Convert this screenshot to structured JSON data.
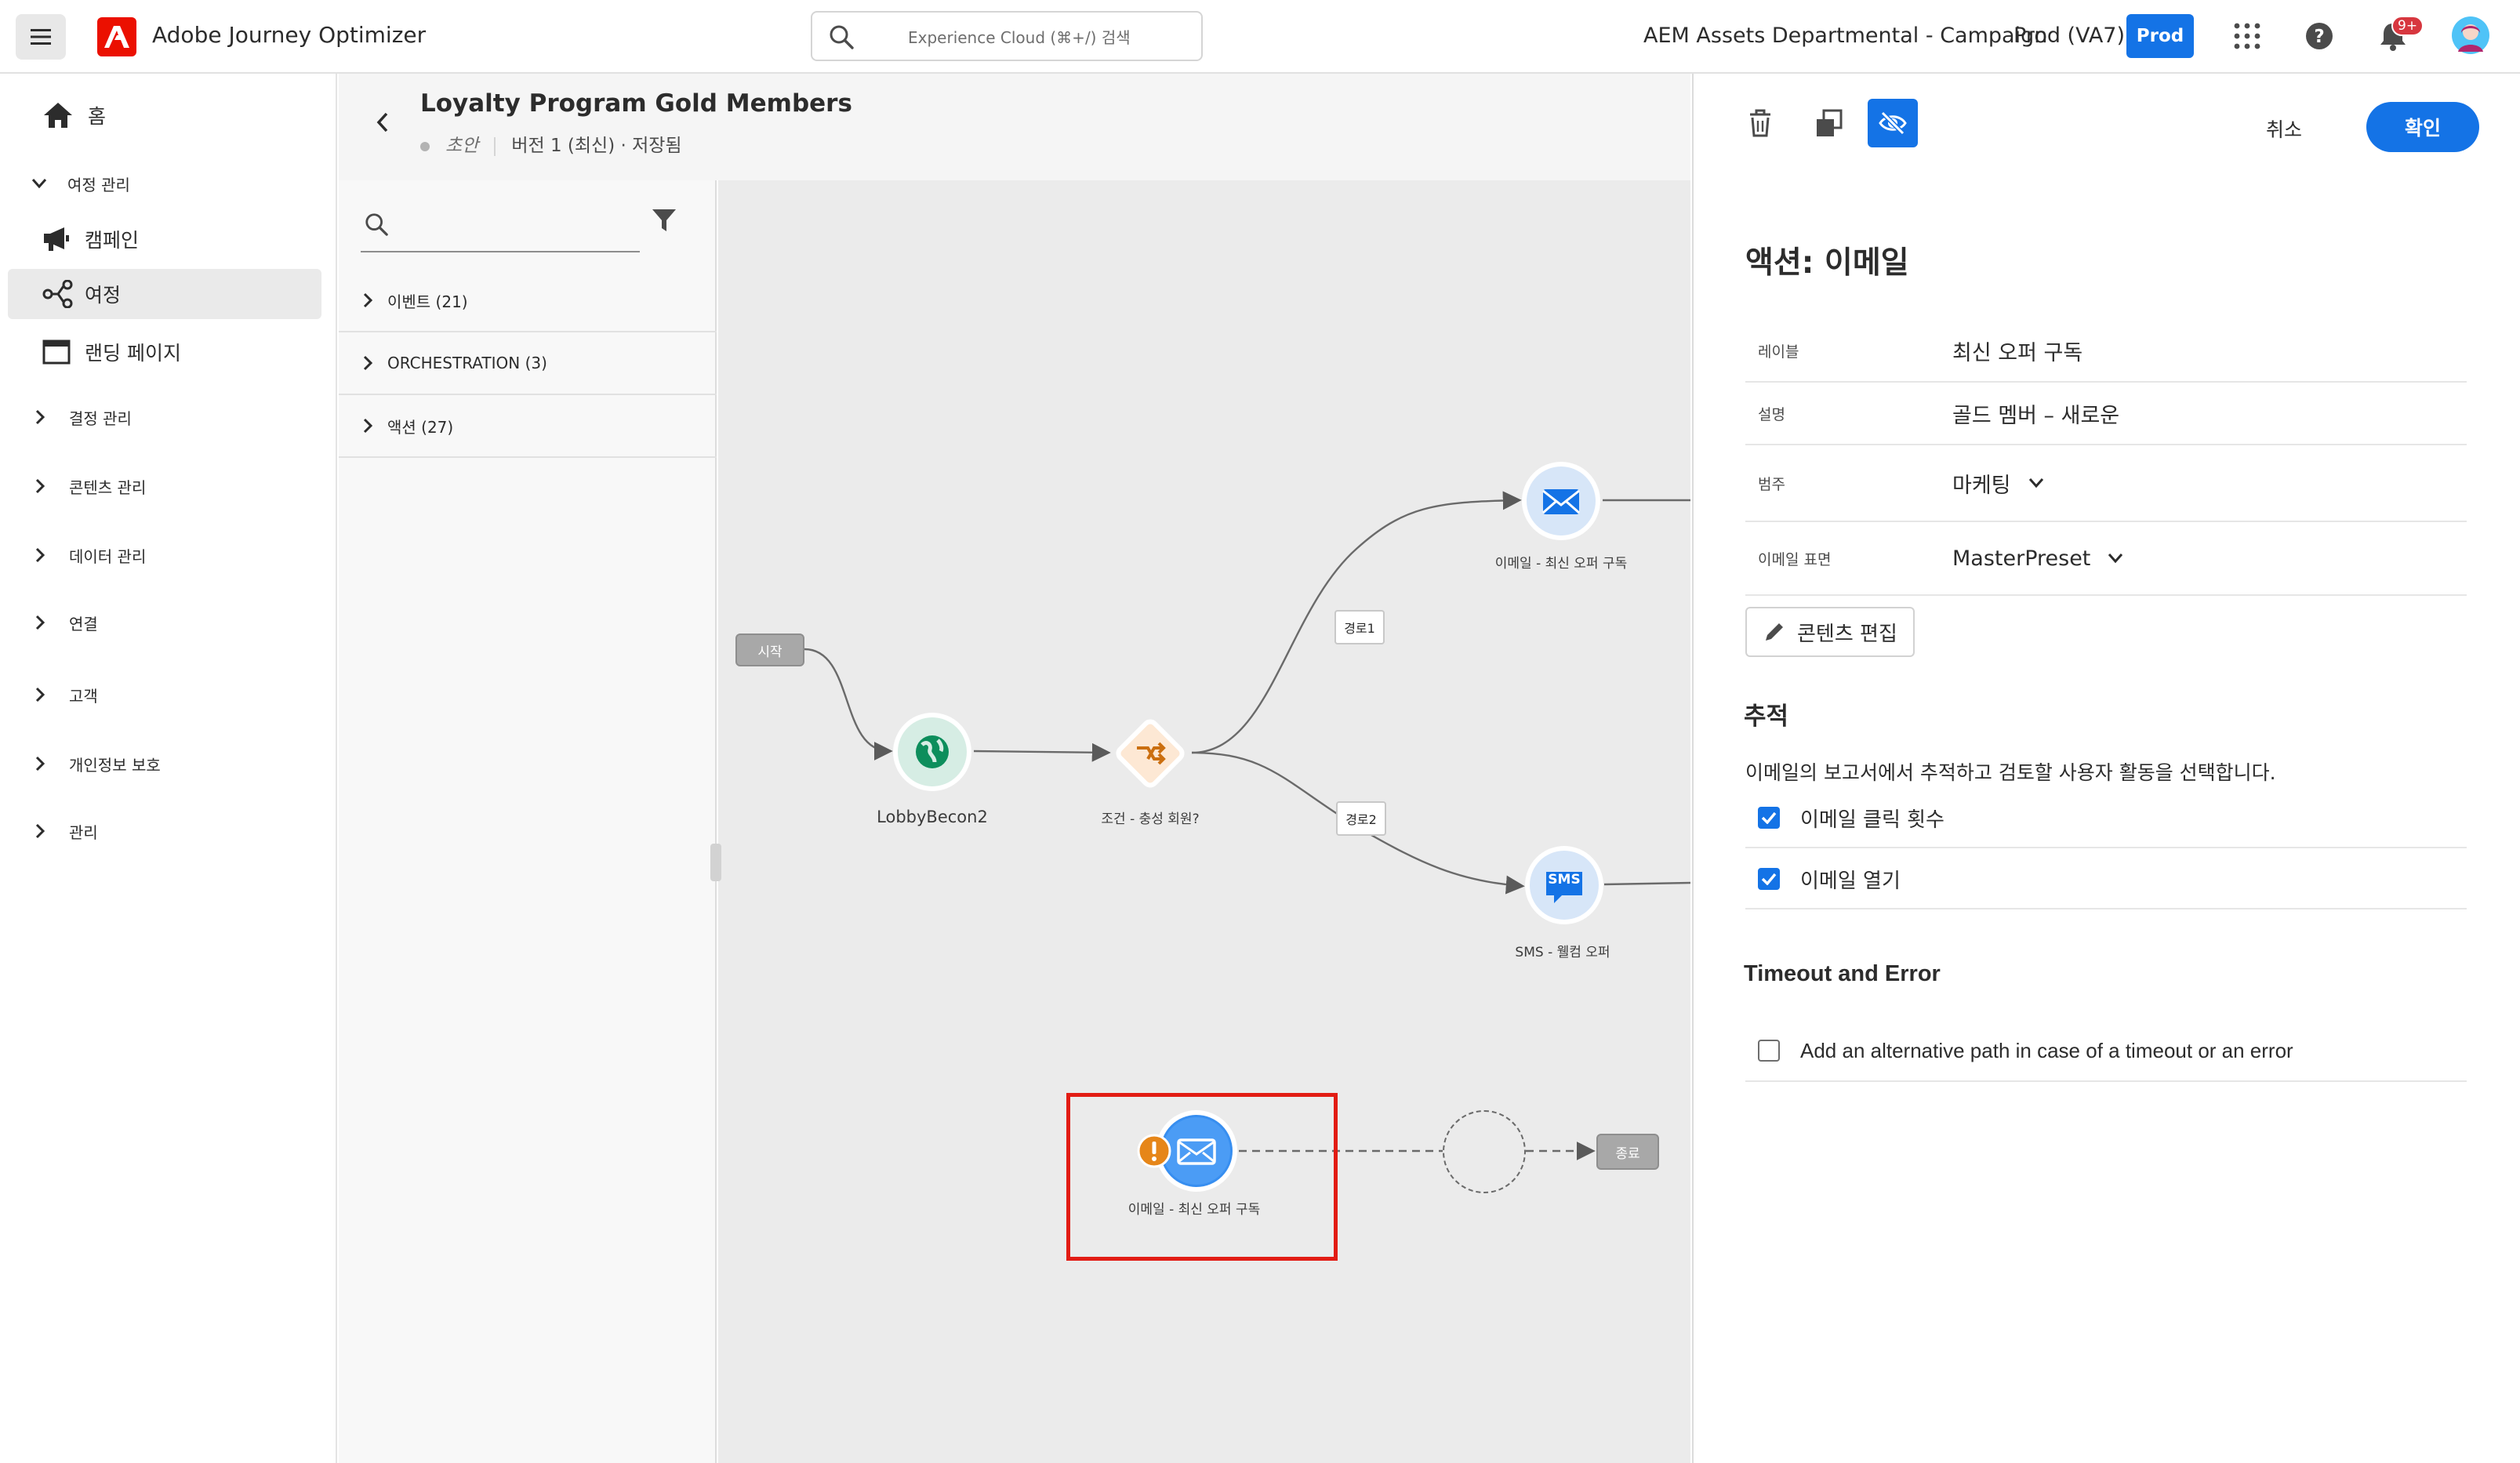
{
  "header": {
    "app_name": "Adobe Journey Optimizer",
    "search_placeholder": "Experience Cloud (⌘+/) 검색",
    "org_name": "AEM Assets Departmental - Campaign",
    "sandbox_name": "Prod (VA7)",
    "env_badge": "Prod",
    "notif_count": "9+"
  },
  "nav": {
    "home": "홈",
    "journey_management": "여정 관리",
    "campaigns": "캠페인",
    "journeys": "여정",
    "landing_pages": "랜딩 페이지",
    "decision_management": "결정 관리",
    "content_management": "콘텐츠 관리",
    "data_management": "데이터 관리",
    "connections": "연결",
    "customers": "고객",
    "privacy": "개인정보 보호",
    "administration": "관리"
  },
  "journey": {
    "title": "Loyalty Program Gold Members",
    "status": "초안",
    "version": "버전 1 (최신) · 저장됨"
  },
  "palette": {
    "items": [
      {
        "label": "이벤트 (21)"
      },
      {
        "label": "ORCHESTRATION (3)"
      },
      {
        "label": "액션 (27)"
      }
    ]
  },
  "canvas": {
    "start": "시작",
    "event_node": "LobbyBecon2",
    "condition_node": "조건 - 충성 회원?",
    "path1": "경로1",
    "path2": "경로2",
    "email_top": "이메일 - 최신 오퍼 구독",
    "sms_node": "SMS - 웰컴 오퍼",
    "sms_icon_text": "SMS",
    "email_selected": "이메일 - 최신 오퍼 구독",
    "end": "종료"
  },
  "panel": {
    "cancel": "취소",
    "confirm": "확인",
    "title": "액션: 이메일",
    "props": [
      {
        "key": "레이블",
        "value": "최신 오퍼 구독"
      },
      {
        "key": "설명",
        "value": "골드 멤버 – 새로운"
      },
      {
        "key": "범주",
        "value": "마케팅"
      },
      {
        "key": "이메일 표면",
        "value": "MasterPreset"
      }
    ],
    "edit_content": "콘텐츠 편집",
    "tracking_title": "추적",
    "tracking_desc": "이메일의 보고서에서 추적하고 검토할 사용자 활동을 선택합니다.",
    "track_clicks": "이메일 클릭 횟수",
    "track_opens": "이메일 열기",
    "timeout_title": "Timeout and Error",
    "timeout_option": "Add an alternative path in case of a timeout or an error"
  },
  "colors": {
    "accent": "#1473e6",
    "adobe_red": "#eb1000",
    "highlight": "#e21c14",
    "warning": "#e68619"
  }
}
